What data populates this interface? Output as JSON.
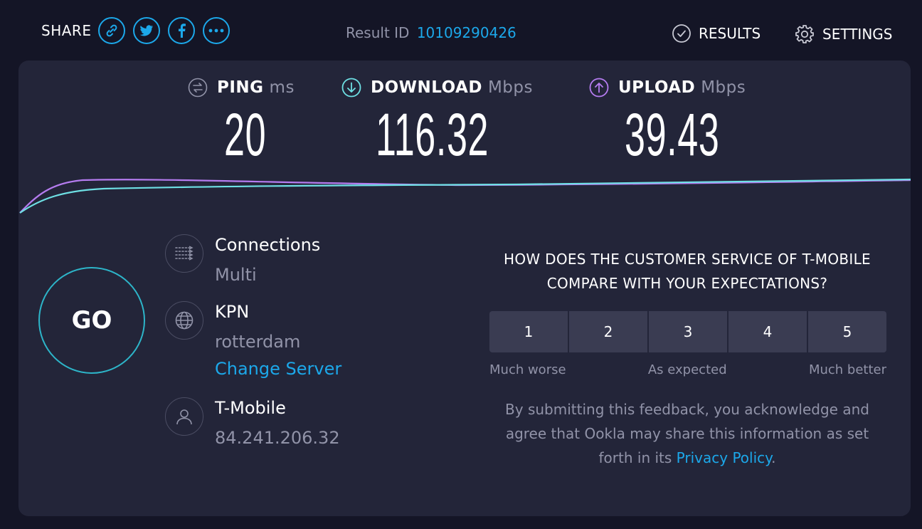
{
  "topbar": {
    "share_label": "SHARE",
    "share_icons": [
      "link-icon",
      "twitter-icon",
      "facebook-icon",
      "more-icon"
    ],
    "result_id_label": "Result ID",
    "result_id": "10109290426",
    "results_label": "RESULTS",
    "settings_label": "SETTINGS"
  },
  "metrics": {
    "ping": {
      "label": "PING",
      "unit": "ms",
      "value": "20"
    },
    "download": {
      "label": "DOWNLOAD",
      "unit": "Mbps",
      "value": "116.32"
    },
    "upload": {
      "label": "UPLOAD",
      "unit": "Mbps",
      "value": "39.43"
    }
  },
  "go_label": "GO",
  "connections": {
    "title": "Connections",
    "value": "Multi"
  },
  "server": {
    "title": "KPN",
    "location": "rotterdam",
    "change_label": "Change Server"
  },
  "provider": {
    "title": "T-Mobile",
    "ip": "84.241.206.32"
  },
  "survey": {
    "question": "HOW DOES THE CUSTOMER SERVICE OF T-MOBILE COMPARE WITH YOUR EXPECTATIONS?",
    "ratings": [
      "1",
      "2",
      "3",
      "4",
      "5"
    ],
    "scale_low": "Much worse",
    "scale_mid": "As expected",
    "scale_high": "Much better",
    "disclaimer": "By submitting this feedback, you acknowledge and agree that Ookla may share this information as set forth in its",
    "privacy_link": "Privacy Policy",
    "disclaimer_end": "."
  },
  "colors": {
    "background": "#141526",
    "panel": "#232539",
    "accent_blue": "#1ca8ea",
    "download_cyan": "#6ee0e4",
    "upload_purple": "#b57cf0",
    "muted_text": "#9193a8"
  }
}
